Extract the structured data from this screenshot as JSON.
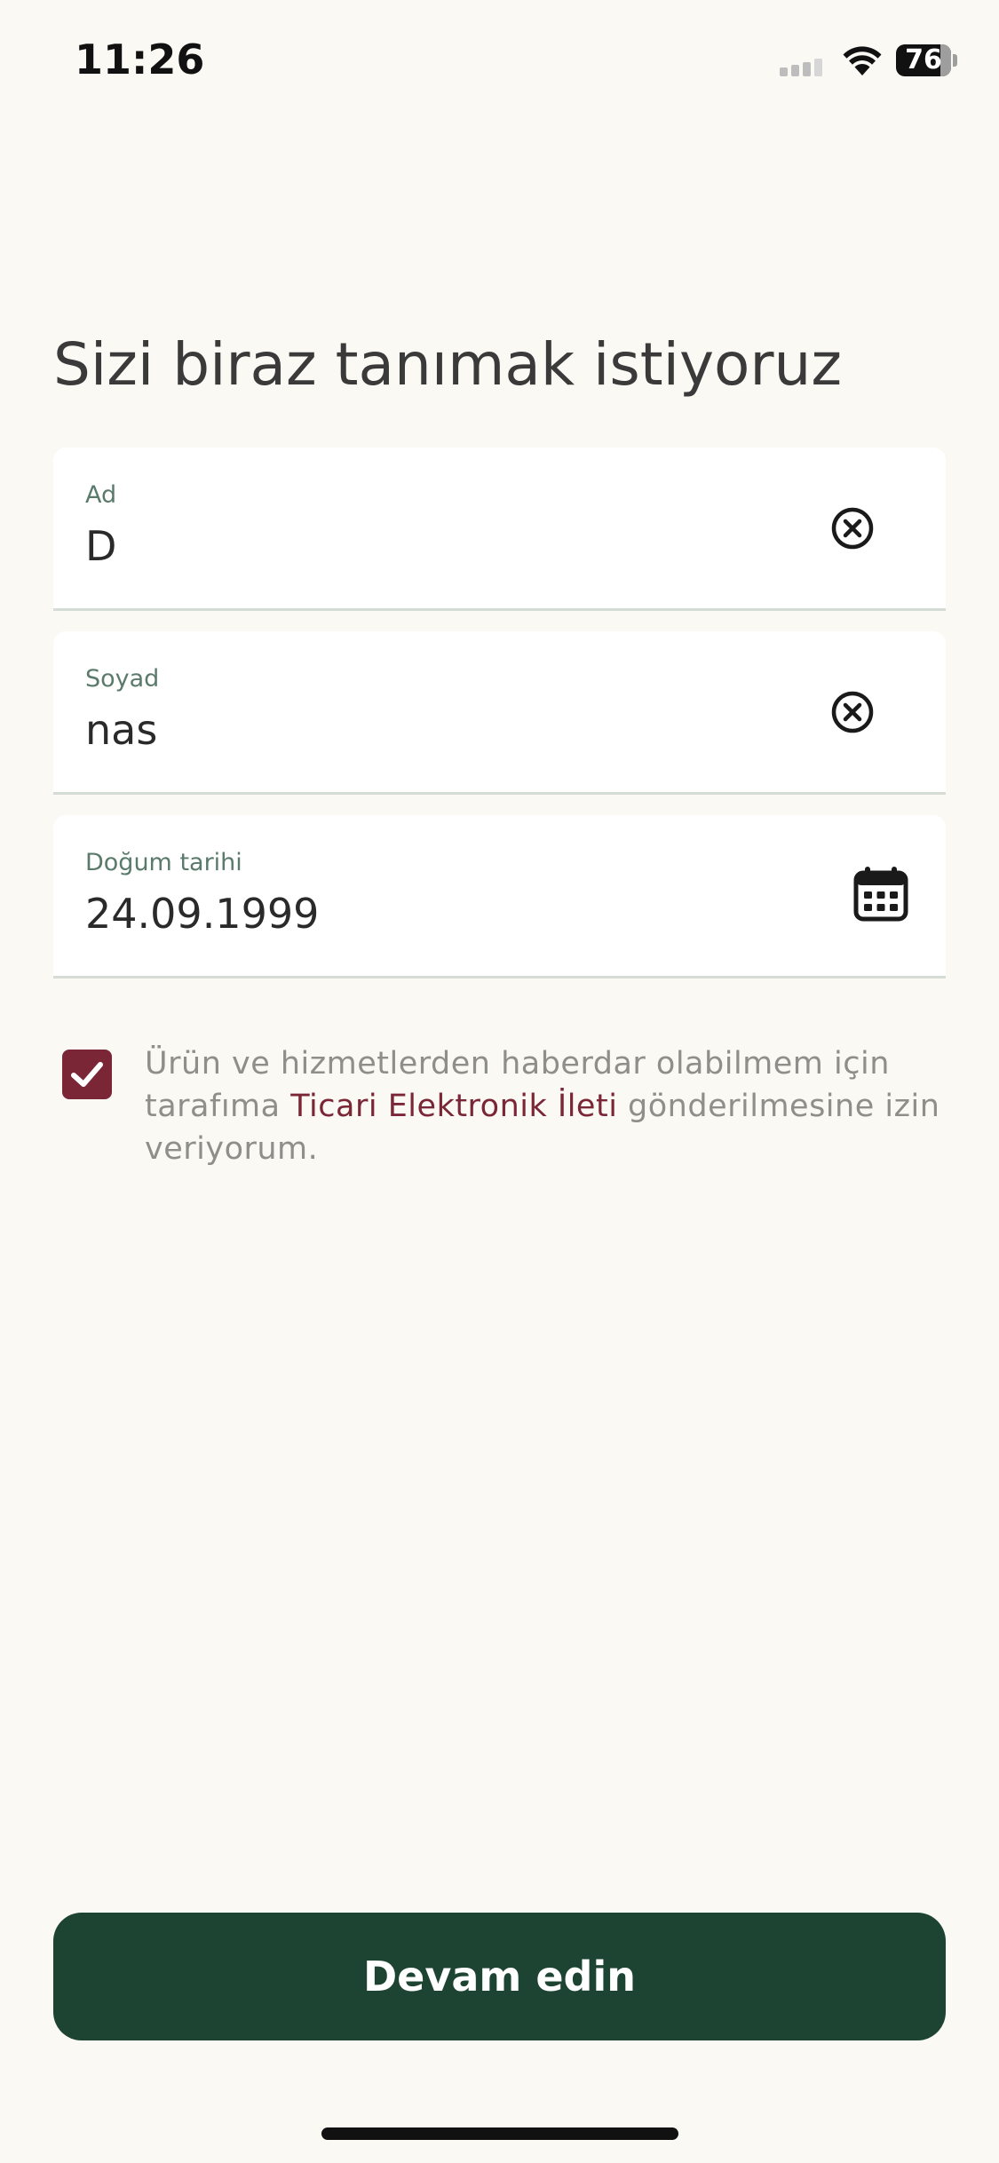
{
  "status_bar": {
    "time": "11:26",
    "battery_level": "76",
    "icons": [
      "cellular-signal-icon",
      "wifi-icon",
      "battery-icon"
    ]
  },
  "page": {
    "title": "Sizi biraz tanımak istiyoruz"
  },
  "form": {
    "first_name": {
      "label": "Ad",
      "value": "D",
      "action_icon": "clear-icon"
    },
    "last_name": {
      "label": "Soyad",
      "value": "nas",
      "action_icon": "clear-icon"
    },
    "birth_date": {
      "label": "Doğum tarihi",
      "value": "24.09.1999",
      "action_icon": "calendar-icon"
    }
  },
  "consent": {
    "checked": true,
    "text_before": "Ürün ve hizmetlerden haberdar olabilmem için tarafıma ",
    "link_text": "Ticari Elektronik İleti",
    "text_after": " gönderilmesine izin veriyorum."
  },
  "actions": {
    "continue_label": "Devam edin"
  },
  "colors": {
    "background": "#faf9f3",
    "primary_button": "#1d4433",
    "accent": "#7b2636",
    "field_label": "#5a7a6c"
  }
}
